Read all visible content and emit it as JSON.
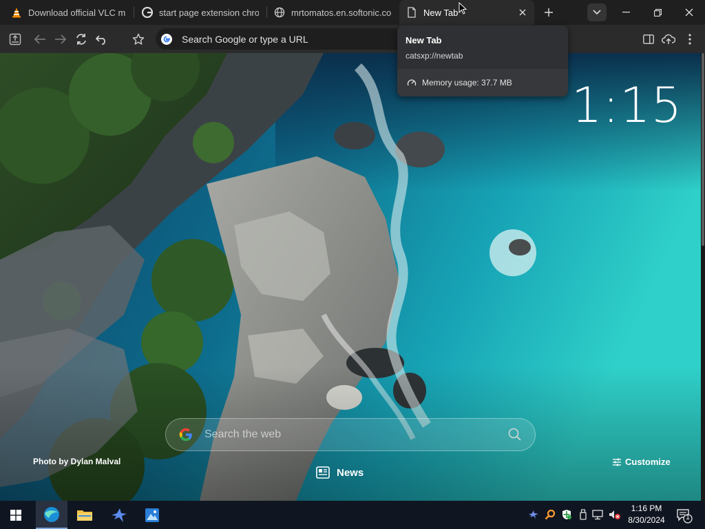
{
  "tabs": [
    {
      "title": "Download official VLC media",
      "favicon": "vlc-cone-icon"
    },
    {
      "title": "start page extension chrome",
      "favicon": "google-icon"
    },
    {
      "title": "mrtomatos.en.softonic.com",
      "favicon": "globe-icon"
    },
    {
      "title": "New Tab",
      "favicon": "page-icon",
      "active": true
    }
  ],
  "omnibox": {
    "text": "Search Google or type a URL"
  },
  "hover_card": {
    "title": "New Tab",
    "url": "catsxp://newtab",
    "memory": "Memory usage: 37.7 MB"
  },
  "newtab": {
    "clock": "1:15",
    "search_placeholder": "Search the web",
    "photo_credit": "Photo by Dylan Malval",
    "customize": "Customize",
    "news": "News"
  },
  "taskbar": {
    "time": "1:16 PM",
    "date": "8/30/2024",
    "notification_count": "1"
  },
  "colors": {
    "tabstrip": "#1f1f1f",
    "toolbar": "#2b2b2b",
    "omnibox": "#1e1e1e",
    "hovercard": "#2f3033",
    "taskbar": "#101621",
    "ocean": "#1aa3b0",
    "rock": "#8c8f8f"
  }
}
